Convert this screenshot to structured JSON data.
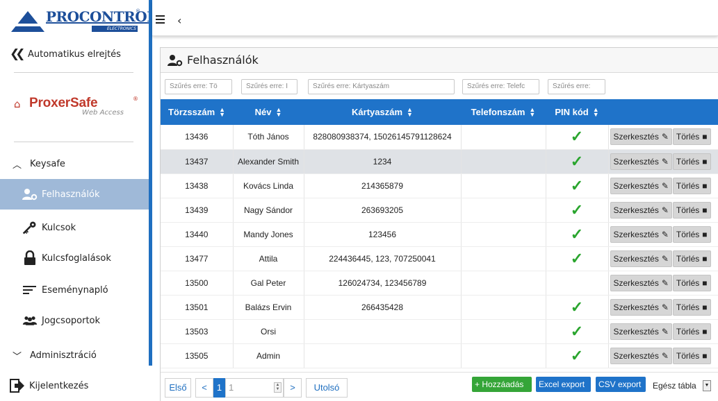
{
  "brand": {
    "logo_text": "PROCONTROL",
    "logo_sub": "ELECTRONICS",
    "product_name": "ProxerSafe",
    "product_sub": "Web Access"
  },
  "sidebar": {
    "hide_label": "Automatikus elrejtés",
    "group_keysafe": "Keysafe",
    "items": [
      {
        "label": "Felhasználók",
        "icon": "user-gear-icon",
        "active": true
      },
      {
        "label": "Kulcsok",
        "icon": "keys-icon"
      },
      {
        "label": "Kulcsfoglalások",
        "icon": "lock-icon"
      },
      {
        "label": "Eseménynapló",
        "icon": "list-icon"
      },
      {
        "label": "Jogcsoportok",
        "icon": "group-icon"
      }
    ],
    "group_admin": "Adminisztráció",
    "logout_label": "Kijelentkezés"
  },
  "topbar": {
    "menu_icon": "hamburger-icon",
    "back_icon": "chevron-left-icon"
  },
  "panel": {
    "title": "Felhasználók"
  },
  "filters": {
    "torzsszam": "Szűrés erre: Tö",
    "nev": "Szűrés erre: I",
    "kartyaszam": "Szűrés erre: Kártyaszám",
    "telefonszam": "Szűrés erre: Telefc",
    "pin": "Szűrés erre:"
  },
  "table": {
    "headers": {
      "torzsszam": "Törzsszám",
      "nev": "Név",
      "kartyaszam": "Kártyaszám",
      "telefonszam": "Telefonszám",
      "pin": "PIN kód"
    },
    "edit_label": "Szerkesztés",
    "delete_label": "Törlés",
    "rows": [
      {
        "id": "13436",
        "name": "Tóth János",
        "cards": "828080938374, 15026145791128624",
        "phone": "",
        "pin": true
      },
      {
        "id": "13437",
        "name": "Alexander Smith",
        "cards": "1234",
        "phone": "",
        "pin": true,
        "selected": true
      },
      {
        "id": "13438",
        "name": "Kovács Linda",
        "cards": "214365879",
        "phone": "",
        "pin": true
      },
      {
        "id": "13439",
        "name": "Nagy Sándor",
        "cards": "263693205",
        "phone": "",
        "pin": true
      },
      {
        "id": "13440",
        "name": "Mandy Jones",
        "cards": "123456",
        "phone": "",
        "pin": true
      },
      {
        "id": "13477",
        "name": "Attila",
        "cards": "224436445, 123, 707250041",
        "phone": "",
        "pin": true
      },
      {
        "id": "13500",
        "name": "Gal Peter",
        "cards": "126024734, 123456789",
        "phone": "",
        "pin": false
      },
      {
        "id": "13501",
        "name": "Balázs Ervin",
        "cards": "266435428",
        "phone": "",
        "pin": true
      },
      {
        "id": "13503",
        "name": "Orsi",
        "cards": "",
        "phone": "",
        "pin": true
      },
      {
        "id": "13505",
        "name": "Admin",
        "cards": "",
        "phone": "",
        "pin": true
      }
    ]
  },
  "pagination": {
    "first": "Első",
    "prev": "<",
    "current": "1",
    "page_input": "1",
    "next": ">",
    "last": "Utolsó"
  },
  "footer_actions": {
    "add": "+ Hozzáadás",
    "excel": "Excel export",
    "csv": "CSV export",
    "scope": "Egész tábla"
  },
  "colors": {
    "accent": "#1f73c9",
    "active_nav": "#9fb9d8",
    "check": "#2aa52e",
    "add_green": "#35a538",
    "brand_blue": "#1d4f9a",
    "proxer_red": "#c0392b"
  }
}
